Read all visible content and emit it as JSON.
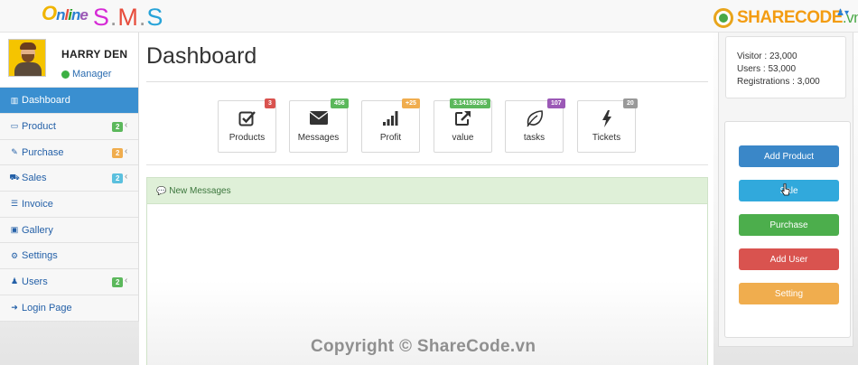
{
  "logo": {
    "online": "Online",
    "sms": "S.M.S"
  },
  "sharecode": {
    "brand": "SHARECODE",
    "tld": ".vn"
  },
  "profile": {
    "name": "HARRY DEN",
    "role": "Manager"
  },
  "sidebar": {
    "items": [
      {
        "label": "Dashboard",
        "icon": "dashboard-icon",
        "glyph": "▥",
        "badge": "",
        "active": true
      },
      {
        "label": "Product",
        "icon": "credit-card-icon",
        "glyph": "▭",
        "badge": "2",
        "badge_color": "#5cb85c"
      },
      {
        "label": "Purchase",
        "icon": "pencil-icon",
        "glyph": "✎",
        "badge": "2",
        "badge_color": "#f0ad4e"
      },
      {
        "label": "Sales",
        "icon": "cart-icon",
        "glyph": "⛟",
        "badge": "2",
        "badge_color": "#5bc0de"
      },
      {
        "label": "Invoice",
        "icon": "list-icon",
        "glyph": "☰",
        "badge": ""
      },
      {
        "label": "Gallery",
        "icon": "image-icon",
        "glyph": "▣",
        "badge": ""
      },
      {
        "label": "Settings",
        "icon": "cogs-icon",
        "glyph": "⚙",
        "badge": ""
      },
      {
        "label": "Users",
        "icon": "user-icon",
        "glyph": "♟",
        "badge": "2",
        "badge_color": "#5cb85c"
      },
      {
        "label": "Login Page",
        "icon": "sign-in-icon",
        "glyph": "➜",
        "badge": ""
      }
    ]
  },
  "main": {
    "title": "Dashboard",
    "tiles": [
      {
        "label": "Products",
        "badge": "3",
        "badge_color": "#d9534f",
        "icon": "check-square-icon"
      },
      {
        "label": "Messages",
        "badge": "456",
        "badge_color": "#5cb85c",
        "icon": "envelope-icon"
      },
      {
        "label": "Profit",
        "badge": "+25",
        "badge_color": "#f0ad4e",
        "icon": "signal-icon"
      },
      {
        "label": "value",
        "badge": "3.14159265",
        "badge_color": "#5cb85c",
        "icon": "external-link-icon"
      },
      {
        "label": "tasks",
        "badge": "107",
        "badge_color": "#9b59b6",
        "icon": "leaf-icon"
      },
      {
        "label": "Tickets",
        "badge": "20",
        "badge_color": "#999999",
        "icon": "bolt-icon"
      }
    ],
    "panel_title": "New Messages"
  },
  "stats": {
    "visitor": "Visitor   : 23,000",
    "users": "Users   : 53,000",
    "registrations": "Registrations   : 3,000"
  },
  "actions": [
    {
      "label": "Add Product",
      "color": "#3a87c8"
    },
    {
      "label": "Sale",
      "color": "#31a9dc"
    },
    {
      "label": "Purchase",
      "color": "#4cae4c"
    },
    {
      "label": "Add User",
      "color": "#d9534f"
    },
    {
      "label": "Setting",
      "color": "#f0ad4e"
    }
  ],
  "watermark": "Copyright © ShareCode.vn"
}
